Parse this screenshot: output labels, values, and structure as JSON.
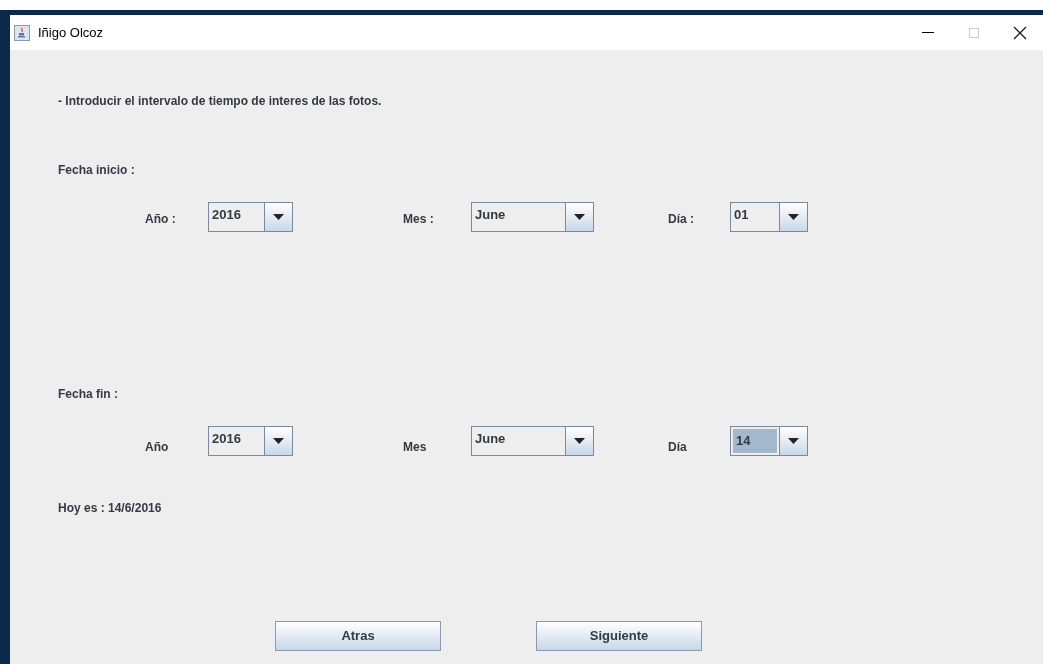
{
  "window": {
    "title": "Iñigo Olcoz"
  },
  "instruction": "- Introducir el intervalo de tiempo de interes de las fotos.",
  "sections": [
    {
      "heading": "Fecha inicio :",
      "fields": [
        {
          "label": "Año :",
          "value": "2016",
          "focused": false
        },
        {
          "label": "Mes :",
          "value": "June",
          "focused": false
        },
        {
          "label": "Día :",
          "value": "01",
          "focused": false
        }
      ]
    },
    {
      "heading": "Fecha fin :",
      "fields": [
        {
          "label": "Año",
          "value": "2016",
          "focused": false
        },
        {
          "label": "Mes",
          "value": "June",
          "focused": false
        },
        {
          "label": "Día",
          "value": "14",
          "focused": true
        }
      ]
    }
  ],
  "today": "Hoy es : 14/6/2016",
  "buttons": [
    "Atras",
    "Siguiente"
  ]
}
